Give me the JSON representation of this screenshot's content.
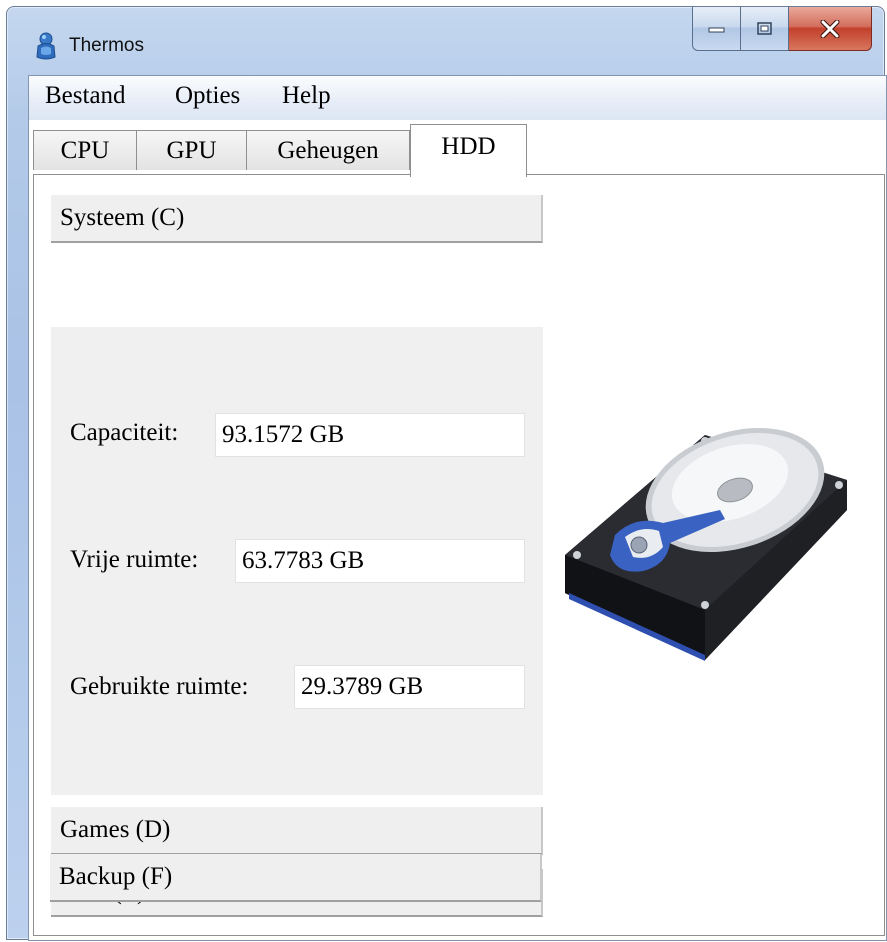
{
  "window": {
    "title": "Thermos",
    "app_icon": "thermos-figure-icon"
  },
  "caption_buttons": {
    "minimize": "minimize-icon",
    "maximize": "maximize-icon",
    "close": "close-icon"
  },
  "menu": {
    "items": [
      "Bestand",
      "Opties",
      "Help"
    ]
  },
  "tabs": {
    "items": [
      "CPU",
      "GPU",
      "Geheugen",
      "HDD"
    ],
    "active": "HDD"
  },
  "drives": {
    "system": {
      "label": "Systeem (C)",
      "capacity_label": "Capaciteit:",
      "capacity_value": "93.1572 GB",
      "free_label": "Vrije ruimte:",
      "free_value": "63.7783 GB",
      "used_label": "Gebruikte ruimte:",
      "used_value": "29.3789 GB"
    },
    "others": [
      "Games (D)",
      "Data (E)",
      "Backup (F)"
    ]
  },
  "illustration": {
    "icon": "hard-drive-icon"
  },
  "colors": {
    "titlebar": "#b3cae8",
    "close_button": "#c2402c",
    "panel": "#f0f0f0"
  }
}
